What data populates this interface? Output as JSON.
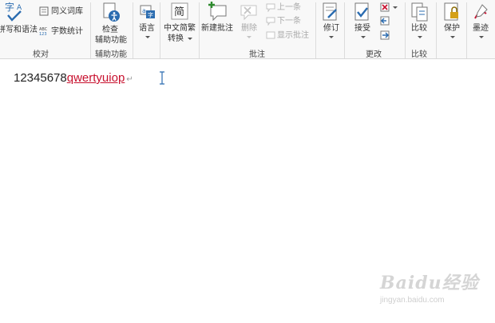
{
  "ribbon": {
    "groups": {
      "proofing": "校对",
      "accessibility": "辅助功能",
      "comments": "批注",
      "changes": "更改",
      "compare": "比较"
    },
    "buttons": {
      "spelling": "拼写和语法",
      "thesaurus": "同义词库",
      "word_count": "字数统计",
      "check_accessibility_1": "检查",
      "check_accessibility_2": "辅助功能",
      "language": "语言",
      "chinese_convert_1": "中文简繁",
      "chinese_convert_2": "转换",
      "new_comment": "新建批注",
      "delete": "删除",
      "previous": "上一条",
      "next": "下一条",
      "show_comments": "显示批注",
      "track": "修订",
      "accept": "接受",
      "compare": "比较",
      "protect": "保护",
      "ink": "墨迹"
    }
  },
  "document": {
    "text_plain": "12345678",
    "text_inserted": "qwertyuiop",
    "paragraph_mark": "↵"
  },
  "watermark": {
    "brand": "Baidu经验",
    "url": "jingyan.baidu.com"
  },
  "colors": {
    "insertion": "#c8102e",
    "accent_blue": "#2b6cb0"
  }
}
